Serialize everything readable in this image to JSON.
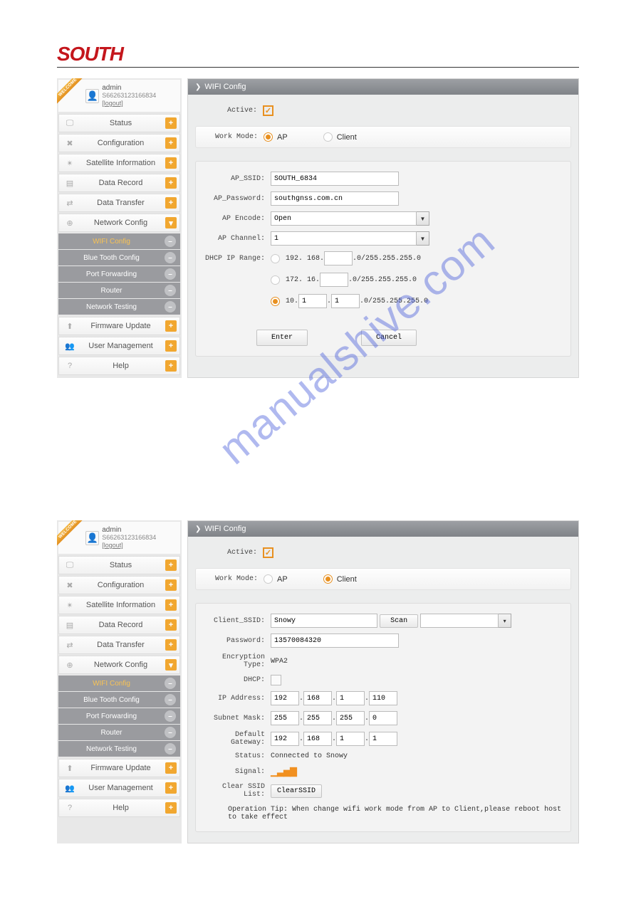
{
  "brand": "SOUTH",
  "watermark": "manualshive.com",
  "user": {
    "name": "admin",
    "id": "S66263123166834",
    "logout": "[logout]"
  },
  "header": {
    "title": "WIFI Config"
  },
  "nav": {
    "status": "Status",
    "configuration": "Configuration",
    "satellite": "Satellite Information",
    "dataRecord": "Data Record",
    "dataTransfer": "Data Transfer",
    "networkConfig": "Network Config",
    "sub": {
      "wifi": "WIFI Config",
      "bluetooth": "Blue Tooth Config",
      "portfw": "Port Forwarding",
      "router": "Router",
      "nettest": "Network Testing"
    },
    "firmware": "Firmware Update",
    "usermgmt": "User Management",
    "help": "Help"
  },
  "ap": {
    "activeLabel": "Active:",
    "workModeLabel": "Work Mode:",
    "modeAp": "AP",
    "modeClient": "Client",
    "ssidLabel": "AP_SSID:",
    "ssidValue": "SOUTH_6834",
    "pwdLabel": "AP_Password:",
    "pwdValue": "southgnss.com.cn",
    "encodeLabel": "AP Encode:",
    "encodeValue": "Open",
    "channelLabel": "AP Channel:",
    "channelValue": "1",
    "dhcpLabel": "DHCP IP Range:",
    "range1a": "192. 168.",
    "range1b": ".0/255.255.255.0",
    "range2a": "172. 16.",
    "range2b": ".0/255.255.255.0",
    "range3a": "10.",
    "range3v1": "1",
    "range3v2": "1",
    "range3b": ".0/255.255.255.0",
    "enter": "Enter",
    "cancel": "Cancel"
  },
  "client": {
    "activeLabel": "Active:",
    "workModeLabel": "Work Mode:",
    "modeAp": "AP",
    "modeClient": "Client",
    "ssidLabel": "Client_SSID:",
    "ssidValue": "Snowy",
    "scan": "Scan",
    "pwdLabel": "Password:",
    "pwdValue": "13570084320",
    "encLabel": "Encryption Type:",
    "encValue": "WPA2",
    "dhcpLabel": "DHCP:",
    "ipLabel": "IP Address:",
    "ip": [
      "192",
      "168",
      "1",
      "110"
    ],
    "maskLabel": "Subnet Mask:",
    "mask": [
      "255",
      "255",
      "255",
      "0"
    ],
    "gwLabel": "Default Gateway:",
    "gw": [
      "192",
      "168",
      "1",
      "1"
    ],
    "statusLabel": "Status:",
    "statusValue": "Connected to Snowy",
    "signalLabel": "Signal:",
    "clearLabel": "Clear SSID List:",
    "clearBtn": "ClearSSID",
    "tip": "Operation Tip: When change wifi work mode from AP to Client,please reboot host to take effect"
  }
}
